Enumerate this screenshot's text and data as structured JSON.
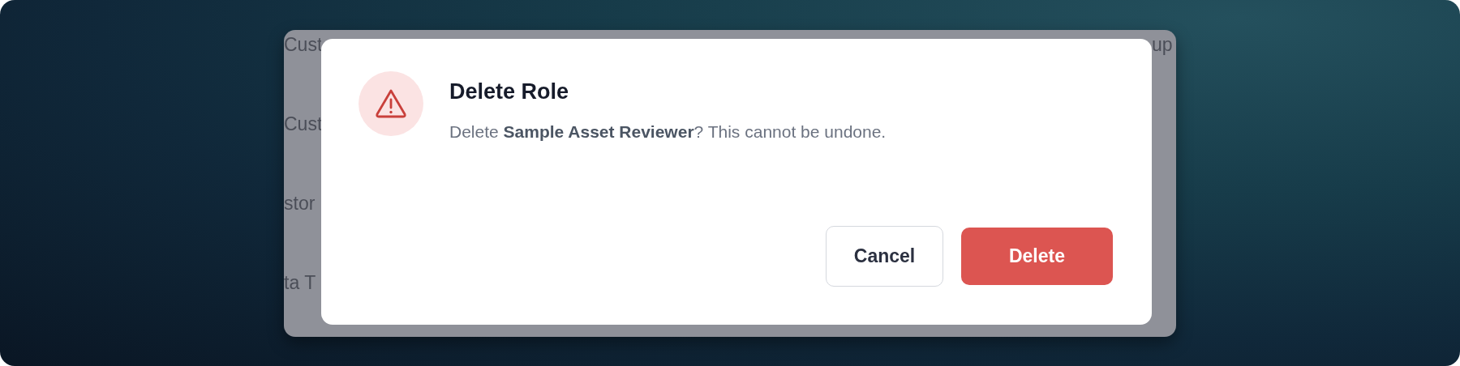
{
  "background": {
    "left_fragments": [
      "Cust",
      "Cust",
      "stor",
      "ta T"
    ],
    "right_fragments": [
      "up"
    ]
  },
  "dialog": {
    "title": "Delete Role",
    "message": "Delete **Sample Asset Reviewer**? This cannot be undone.",
    "buttons": [
      {
        "label": "Cancel",
        "kind": "secondary"
      },
      {
        "label": "Delete",
        "kind": "danger"
      }
    ]
  }
}
